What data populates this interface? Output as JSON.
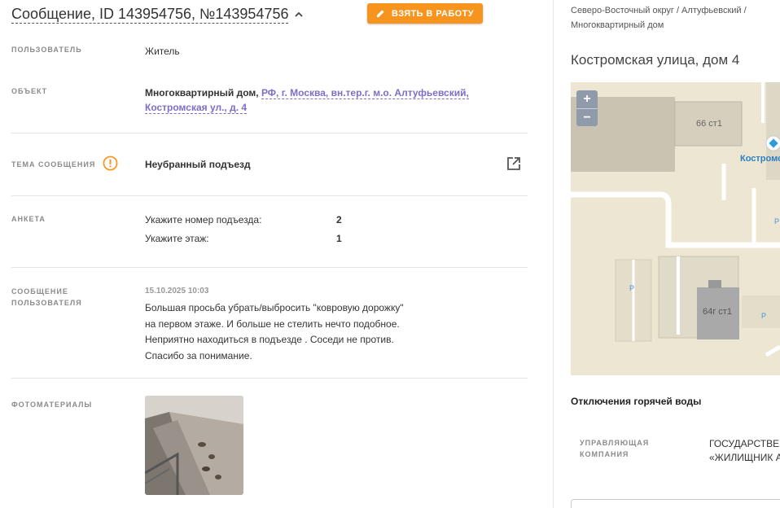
{
  "header": {
    "title": "Сообщение, ID 143954756, №143954756",
    "take_button": "ВЗЯТЬ В РАБОТУ"
  },
  "fields": {
    "user_label": "ПОЛЬЗОВАТЕЛЬ",
    "user_value": "Житель",
    "object_label": "ОБЪЕКТ",
    "object_type": "Многоквартирный дом,",
    "object_address": "РФ, г. Москва, вн.тер.г. м.о. Алтуфьевский, Костромская ул., д. 4",
    "topic_label": "ТЕМА СООБЩЕНИЯ",
    "topic_value": "Неубранный подъезд",
    "anketa_label": "АНКЕТА",
    "anketa": [
      {
        "question": "Укажите номер подъезда:",
        "answer": "2"
      },
      {
        "question": "Укажите этаж:",
        "answer": "1"
      }
    ],
    "message_label_1": "СООБЩЕНИЕ",
    "message_label_2": "ПОЛЬЗОВАТЕЛЯ",
    "message_date": "15.10.2025 10:03",
    "message_lines": [
      "Большая просьба убрать/выбросить \"ковровую дорожку\"",
      "на первом этаже. И больше не стелить нечто подобное.",
      "Неприятно находиться в подъезде . Соседи не против.",
      "Спасибо за понимание."
    ],
    "photos_label": "ФОТОМАТЕРИАЛЫ"
  },
  "sidebar": {
    "breadcrumb_1": "Северо-Восточный округ / Алтуфьевский /",
    "breadcrumb_2": "Многоквартирный дом",
    "street": "Костромская улица, дом 4",
    "map": {
      "zoom_in": "+",
      "zoom_out": "−",
      "label_building_1": "66 ст1",
      "label_building_2": "64г ст1",
      "label_street": "Костромс",
      "parking": "P"
    },
    "hot_water": "Отключения горячей воды",
    "uk_label_1": "УПРАВЛЯЮЩАЯ",
    "uk_label_2": "КОМПАНИЯ",
    "uk_value_1": "ГОСУДАРСТВЕ",
    "uk_value_2": "«ЖИЛИЩНИК А"
  },
  "colors": {
    "accent": "#f7941d",
    "link": "#7b6fc6",
    "warning": "#f7941d"
  }
}
